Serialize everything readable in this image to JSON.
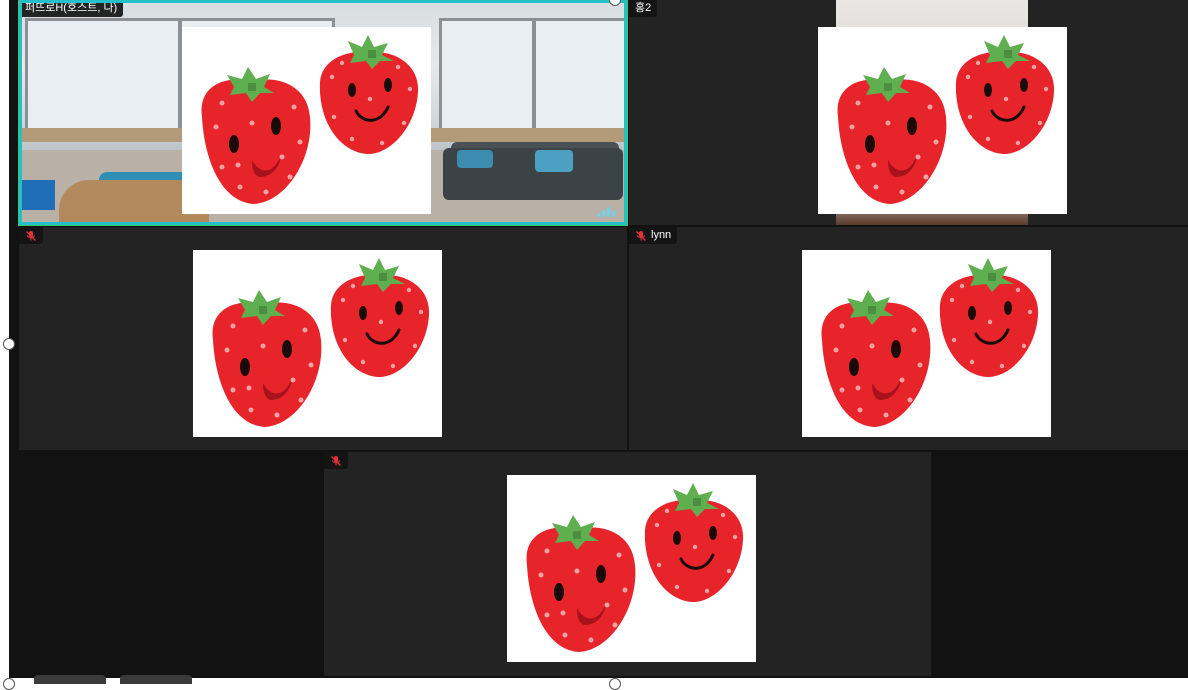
{
  "participants": [
    {
      "id": "p1",
      "name": "퍼뜨로H(호스트, 나)",
      "muted": false,
      "speaking": true,
      "show_mic": false
    },
    {
      "id": "p2",
      "name": "홍2",
      "muted": false,
      "speaking": false,
      "show_mic": false
    },
    {
      "id": "p3",
      "name": "",
      "muted": true,
      "speaking": false,
      "show_mic": true
    },
    {
      "id": "p4",
      "name": "lynn",
      "muted": true,
      "speaking": false,
      "show_mic": true
    },
    {
      "id": "p5",
      "name": "",
      "muted": true,
      "speaking": false,
      "show_mic": true
    }
  ],
  "overlay_image": {
    "icon": "strawberry-pair-illustration",
    "background": "#ffffff",
    "berry_color": "#e8242b",
    "leaf_color": "#5fae4f",
    "seed_color": "#f4a3a3"
  },
  "colors": {
    "active_border": "#23c0c9",
    "tile_bg": "#232323",
    "stage_bg": "#121212",
    "muted_icon": "#e0323a"
  }
}
